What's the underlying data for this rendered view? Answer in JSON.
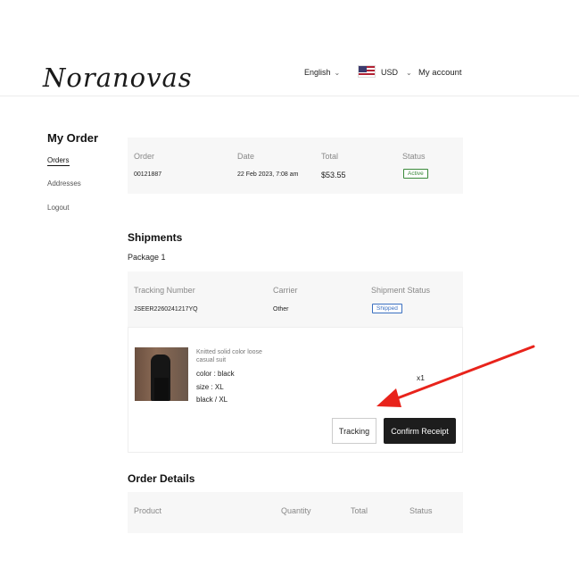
{
  "header": {
    "logo": "Noranovas",
    "language": "English",
    "currency": "USD",
    "account": "My account"
  },
  "sidebar": {
    "title": "My Order",
    "items": [
      {
        "label": "Orders"
      },
      {
        "label": "Addresses"
      },
      {
        "label": "Logout"
      }
    ]
  },
  "order": {
    "headers": {
      "order": "Order",
      "date": "Date",
      "total": "Total",
      "status": "Status"
    },
    "number": "00121887",
    "date": "22 Feb 2023, 7:08 am",
    "total": "$53.55",
    "status": "Active"
  },
  "shipments": {
    "title": "Shipments",
    "package": "Package 1",
    "headers": {
      "tracking": "Tracking Number",
      "carrier": "Carrier",
      "status": "Shipment Status"
    },
    "tracking_number": "JSEER2260241217YQ",
    "carrier": "Other",
    "status": "Shipped",
    "item": {
      "name": "Knitted solid color loose casual suit",
      "color": "color : black",
      "size": "size : XL",
      "variant": "black / XL",
      "quantity": "x1"
    },
    "tracking_button": "Tracking",
    "confirm_button": "Confirm Receipt"
  },
  "order_details": {
    "title": "Order Details",
    "headers": {
      "product": "Product",
      "quantity": "Quantity",
      "total": "Total",
      "status": "Status"
    }
  },
  "colors": {
    "arrow": "#e8231b",
    "confirm_button_bg": "#1d1d1d",
    "active_badge": "#3a8a3a",
    "shipped_badge": "#3a6fc0"
  }
}
